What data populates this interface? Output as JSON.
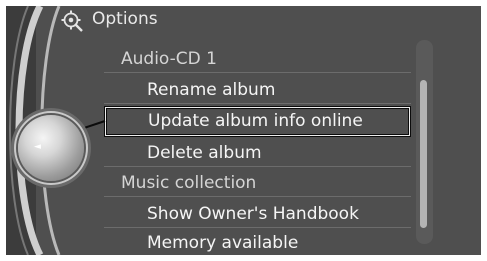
{
  "header": {
    "title": "Options",
    "icon": "settings-icon"
  },
  "menu": {
    "sections": [
      {
        "heading": "Audio-CD 1",
        "items": [
          "Rename album",
          "Update album info online",
          "Delete album"
        ]
      },
      {
        "heading": "Music collection",
        "items": [
          "Show Owner's Handbook",
          "Memory available"
        ]
      }
    ],
    "selected_item": "Update album info online"
  },
  "controller": {
    "direction_icon": "left-arrow-icon",
    "glyph": "◄"
  },
  "colors": {
    "background": "#4f4f4f",
    "text": "#f5f5f5",
    "heading_text": "#d5d5d5",
    "selection_border": "#0c0c0c"
  }
}
